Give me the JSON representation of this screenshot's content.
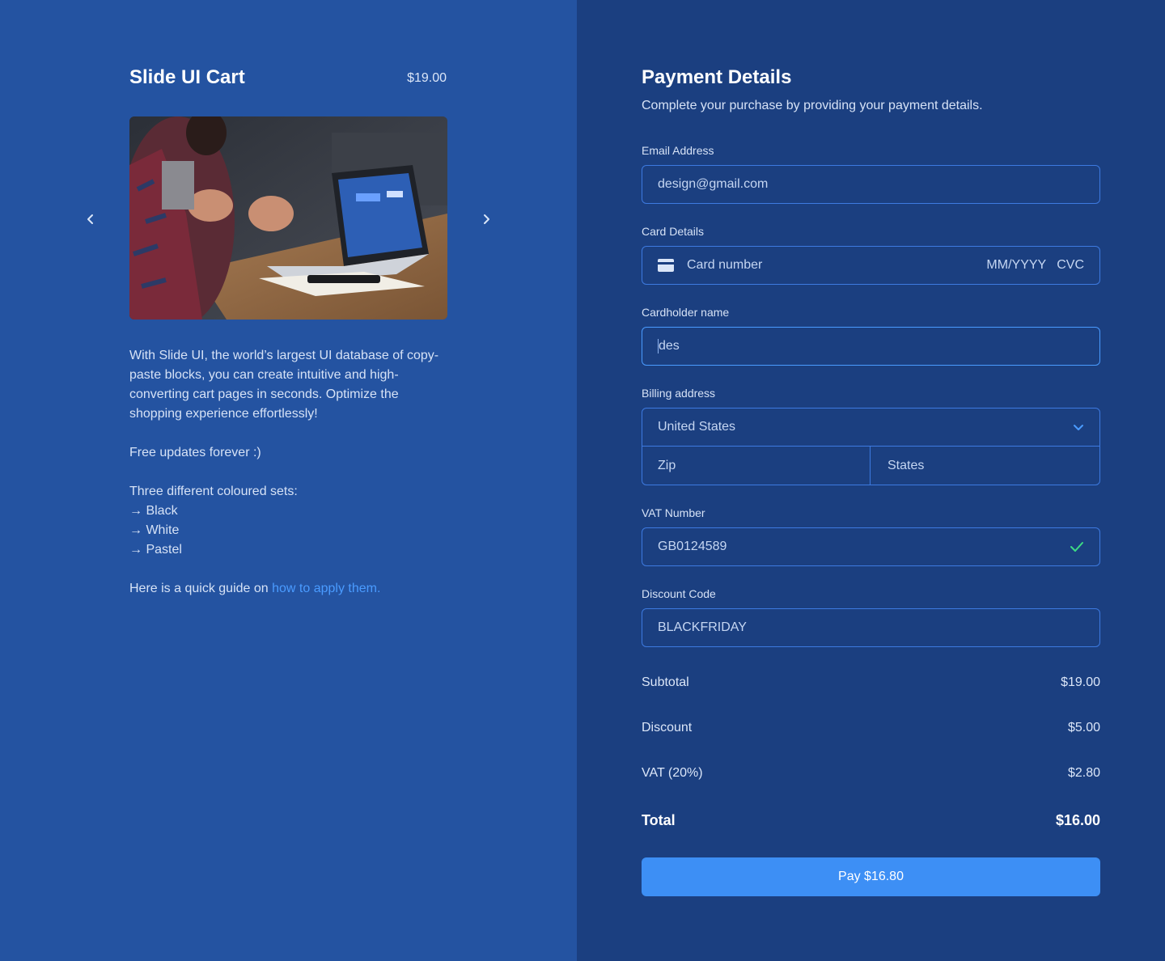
{
  "colors": {
    "left_bg": "#2453a1",
    "right_bg": "#1b3f80",
    "field_border": "#3d7ae0",
    "accent": "#3d8ff5",
    "link": "#4a9bff",
    "valid_check": "#3ddc84"
  },
  "cart": {
    "title": "Slide UI Cart",
    "price": "$19.00",
    "prev_icon": "chevron-left-icon",
    "next_icon": "chevron-right-icon",
    "description": "With Slide UI, the world’s largest UI database of copy-paste blocks, you can create intuitive and high-converting cart pages in seconds. Optimize the shopping experience effortlessly!",
    "updates": "Free updates forever :)",
    "sets_heading": "Three different coloured sets:",
    "sets": [
      "→ Black",
      "→ White",
      "→ Pastel"
    ],
    "guide_prefix": "Here is a quick guide on ",
    "guide_link": "how to apply them."
  },
  "payment": {
    "title": "Payment Details",
    "subtitle": "Complete your purchase by providing your payment details.",
    "email": {
      "label": "Email Address",
      "value": "design@gmail.com"
    },
    "card": {
      "label": "Card Details",
      "number_placeholder": "Card number",
      "expiry_placeholder": "MM/YYYY",
      "cvc_placeholder": "CVC",
      "icon": "credit-card-icon"
    },
    "cardholder": {
      "label": "Cardholder name",
      "value": "des"
    },
    "billing": {
      "label": "Billing address",
      "country": "United States",
      "zip_placeholder": "Zip",
      "state_placeholder": "States",
      "icon": "chevron-down-icon"
    },
    "vat": {
      "label": "VAT Number",
      "value": "GB0124589",
      "icon": "check-icon"
    },
    "discount_code": {
      "label": "Discount Code",
      "value": "BLACKFRIDAY"
    },
    "summary": {
      "subtotal_label": "Subtotal",
      "subtotal": "$19.00",
      "discount_label": "Discount",
      "discount": "$5.00",
      "vat_label": "VAT (20%)",
      "vat": "$2.80",
      "total_label": "Total",
      "total": "$16.00"
    },
    "pay_button": "Pay $16.80"
  }
}
